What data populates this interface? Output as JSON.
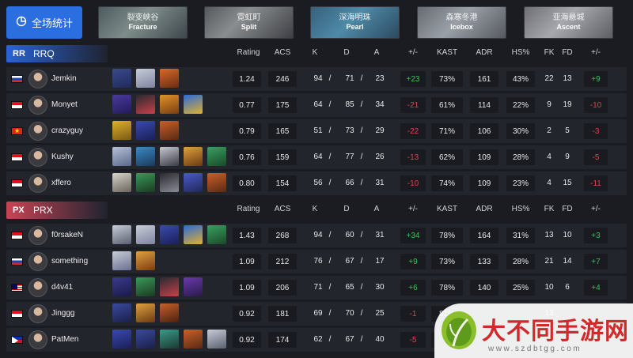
{
  "overall_button": {
    "label": "全场统计",
    "icon": "pie-chart-icon"
  },
  "maps": [
    {
      "cn": "裂变峡谷",
      "en": "Fracture"
    },
    {
      "cn": "霓虹町",
      "en": "Split"
    },
    {
      "cn": "深海明珠",
      "en": "Pearl"
    },
    {
      "cn": "森寒冬港",
      "en": "Icebox"
    },
    {
      "cn": "亚海悬城",
      "en": "Ascent"
    }
  ],
  "columns": [
    "Rating",
    "ACS",
    "K",
    "D",
    "A",
    "+/-",
    "KAST",
    "ADR",
    "HS%",
    "FK",
    "FD",
    "+/-"
  ],
  "teams": [
    {
      "name": "RRQ",
      "logo": "RR",
      "accent": "#2a63d6",
      "players": [
        {
          "flag": "ru",
          "name": "Jemkin",
          "agents": [
            [
              "#3a4a8c",
              "#1f2a5c"
            ],
            [
              "#c8ccd8",
              "#7e84a0"
            ],
            [
              "#d86a2a",
              "#6a2c12"
            ]
          ],
          "rating": "1.24",
          "acs": "246",
          "k": "94",
          "d": "71",
          "a": "23",
          "pm": "+23",
          "kast": "73%",
          "adr": "161",
          "hs": "43%",
          "fk": "22",
          "fd": "13",
          "fpm": "+9"
        },
        {
          "flag": "id",
          "name": "Monyet",
          "agents": [
            [
              "#4a3a9c",
              "#221a5a"
            ],
            [
              "#2a2a2e",
              "#c8404a"
            ],
            [
              "#e0922a",
              "#7a3e10"
            ],
            [
              "#2a6ad8",
              "#e0b030"
            ]
          ],
          "rating": "0.77",
          "acs": "175",
          "k": "64",
          "d": "85",
          "a": "34",
          "pm": "-21",
          "kast": "61%",
          "adr": "114",
          "hs": "22%",
          "fk": "9",
          "fd": "19",
          "fpm": "-10"
        },
        {
          "flag": "vn",
          "name": "crazyguy",
          "agents": [
            [
              "#e0b030",
              "#7a5a10"
            ],
            [
              "#3a4aac",
              "#1a1f5a"
            ],
            [
              "#c8602a",
              "#5a2a12"
            ]
          ],
          "rating": "0.79",
          "acs": "165",
          "k": "51",
          "d": "73",
          "a": "29",
          "pm": "-22",
          "kast": "71%",
          "adr": "106",
          "hs": "30%",
          "fk": "2",
          "fd": "5",
          "fpm": "-3"
        },
        {
          "flag": "id",
          "name": "Kushy",
          "agents": [
            [
              "#b8c0d8",
              "#5a6a8a"
            ],
            [
              "#3a8ac8",
              "#1a3a5a"
            ],
            [
              "#c8c8d0",
              "#3a3a46"
            ],
            [
              "#e0a040",
              "#6a3a10"
            ],
            [
              "#3aa060",
              "#1a4a2a"
            ]
          ],
          "rating": "0.76",
          "acs": "159",
          "k": "64",
          "d": "77",
          "a": "26",
          "pm": "-13",
          "kast": "62%",
          "adr": "109",
          "hs": "28%",
          "fk": "4",
          "fd": "9",
          "fpm": "-5"
        },
        {
          "flag": "id",
          "name": "xffero",
          "agents": [
            [
              "#d8d4cc",
              "#6a645a"
            ],
            [
              "#3a9a5a",
              "#1a3a22"
            ],
            [
              "#2a2a30",
              "#8a8a96"
            ],
            [
              "#4a5ac8",
              "#20285a"
            ],
            [
              "#c8602a",
              "#5a2a12"
            ]
          ],
          "rating": "0.80",
          "acs": "154",
          "k": "56",
          "d": "66",
          "a": "31",
          "pm": "-10",
          "kast": "74%",
          "adr": "109",
          "hs": "23%",
          "fk": "4",
          "fd": "15",
          "fpm": "-11"
        }
      ]
    },
    {
      "name": "PRX",
      "logo": "PX",
      "accent": "#c94454",
      "players": [
        {
          "flag": "id",
          "name": "f0rsakeN",
          "agents": [
            [
              "#c8ccd8",
              "#5a6070"
            ],
            [
              "#c8ccd8",
              "#7e84a0"
            ],
            [
              "#3a4aac",
              "#1a1f5a"
            ],
            [
              "#2a6ad8",
              "#e0b030"
            ],
            [
              "#3aa060",
              "#1a4a2a"
            ]
          ],
          "rating": "1.43",
          "acs": "268",
          "k": "94",
          "d": "60",
          "a": "31",
          "pm": "+34",
          "kast": "78%",
          "adr": "164",
          "hs": "31%",
          "fk": "13",
          "fd": "10",
          "fpm": "+3"
        },
        {
          "flag": "ru",
          "name": "something",
          "agents": [
            [
              "#c8ccd8",
              "#6a7090"
            ],
            [
              "#e0a040",
              "#7a3e10"
            ]
          ],
          "rating": "1.09",
          "acs": "212",
          "k": "76",
          "d": "67",
          "a": "17",
          "pm": "+9",
          "kast": "73%",
          "adr": "133",
          "hs": "28%",
          "fk": "21",
          "fd": "14",
          "fpm": "+7"
        },
        {
          "flag": "my",
          "name": "d4v41",
          "agents": [
            [
              "#3a3a8c",
              "#1a1a4a"
            ],
            [
              "#3a9a5a",
              "#1a3a22"
            ],
            [
              "#2a2a30",
              "#c8404a"
            ],
            [
              "#6a3aac",
              "#2a1a4a"
            ]
          ],
          "rating": "1.09",
          "acs": "206",
          "k": "71",
          "d": "65",
          "a": "30",
          "pm": "+6",
          "kast": "78%",
          "adr": "140",
          "hs": "25%",
          "fk": "10",
          "fd": "6",
          "fpm": "+4"
        },
        {
          "flag": "sg",
          "name": "Jinggg",
          "agents": [
            [
              "#3a4a9c",
              "#1a1f4a"
            ],
            [
              "#e0a040",
              "#6a3a10"
            ],
            [
              "#c8602a",
              "#4a2010"
            ]
          ],
          "rating": "0.92",
          "acs": "181",
          "k": "69",
          "d": "70",
          "a": "25",
          "pm": "-1",
          "kast": "81%",
          "adr": "",
          "hs": "",
          "fk": "13",
          "fd": "",
          "fpm": ""
        },
        {
          "flag": "ph",
          "name": "PatMen",
          "agents": [
            [
              "#3a4aac",
              "#1a1f5a"
            ],
            [
              "#3a4a9c",
              "#1a1f4a"
            ],
            [
              "#3a9a8a",
              "#1a3a32"
            ],
            [
              "#c8602a",
              "#5a2a12"
            ],
            [
              "#c8ccd8",
              "#5a6070"
            ]
          ],
          "rating": "0.92",
          "acs": "174",
          "k": "62",
          "d": "67",
          "a": "40",
          "pm": "-5",
          "kast": "",
          "adr": "",
          "hs": "",
          "fk": "",
          "fd": "",
          "fpm": ""
        }
      ]
    }
  ],
  "watermark": {
    "title": "大不同手游网",
    "url": "www.szdbtgg.com"
  }
}
